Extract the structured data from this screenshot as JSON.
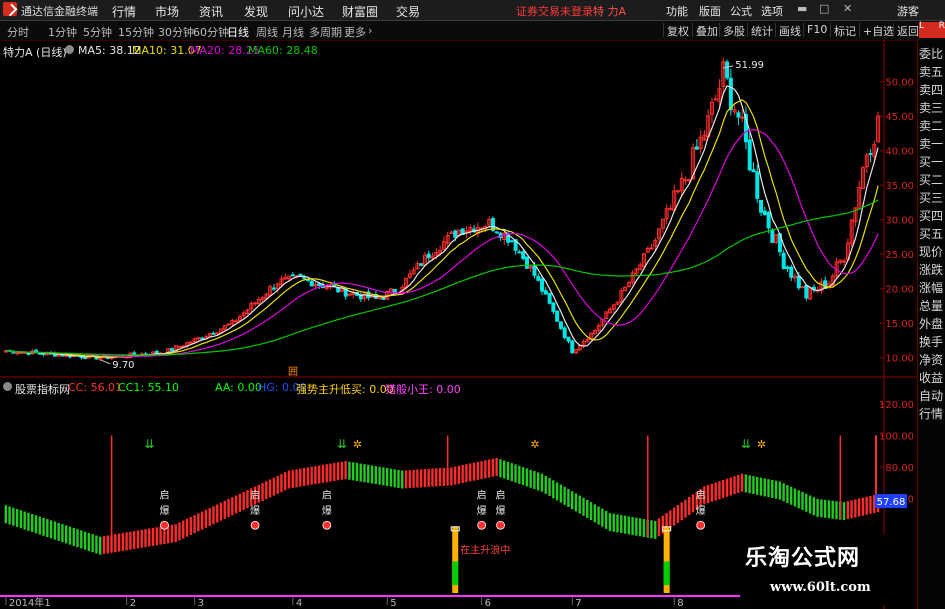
{
  "app": {
    "title": "通达信金融终端",
    "login_status": "证券交易未登录",
    "stock": "特 力A",
    "account": "游客"
  },
  "menu": [
    "行情",
    "市场",
    "资讯",
    "发现",
    "问小达",
    "财富圈",
    "交易"
  ],
  "right_menu": [
    "功能",
    "版面",
    "公式",
    "选项"
  ],
  "timeframes": [
    {
      "label": "分时",
      "active": false
    },
    {
      "label": "1分钟",
      "active": false
    },
    {
      "label": "5分钟",
      "active": false
    },
    {
      "label": "15分钟",
      "active": false
    },
    {
      "label": "30分钟",
      "active": false
    },
    {
      "label": "60分钟",
      "active": false
    },
    {
      "label": "日线",
      "active": true
    },
    {
      "label": "周线",
      "active": false
    },
    {
      "label": "月线",
      "active": false
    },
    {
      "label": "多周期",
      "active": false
    },
    {
      "label": "更多",
      "active": false
    }
  ],
  "tools": [
    "复权",
    "叠加",
    "多股",
    "统计",
    "画线",
    "F10",
    "标记",
    "+自选",
    "返回"
  ],
  "side_panel": {
    "badge_top": "L",
    "badge_sub": "R",
    "items": [
      "委比",
      "卖五",
      "卖四",
      "卖三",
      "卖二",
      "卖一",
      "买一",
      "买二",
      "买三",
      "买四",
      "买五",
      "现价",
      "涨跌",
      "涨幅",
      "总量",
      "外盘",
      "换手",
      "净资",
      "收益",
      "自动",
      "行情"
    ]
  },
  "colors": {
    "up": "#ff2d2d",
    "down": "#00e6e6",
    "ma5": "#e8e8e8",
    "ma10": "#e8e000",
    "ma20": "#e000e0",
    "ma60": "#00c800",
    "cc": "#ff3030",
    "cc1": "#00ff00",
    "aa": "#00ff00",
    "ribbon_up": "#ff2a2a",
    "ribbon_down": "#22cc22"
  },
  "chart_data": [
    {
      "type": "candlestick",
      "title": "特力A (日线)",
      "legend": [
        {
          "label": "MA5: 38.12",
          "color": "#e8e8e8"
        },
        {
          "label": "MA10: 31.07",
          "color": "#e8e000"
        },
        {
          "label": "MA20: 28.25",
          "color": "#e000e0"
        },
        {
          "label": "MA60: 28.48",
          "color": "#00c800"
        }
      ],
      "ylim": [
        7.5,
        54
      ],
      "yticks": [
        "50.00",
        "45.00",
        "40.00",
        "35.00",
        "30.00",
        "25.00",
        "20.00",
        "15.00",
        "10.00"
      ],
      "ytick_values": [
        50,
        45,
        40,
        35,
        30,
        25,
        20,
        15,
        10
      ],
      "anchors": [
        [
          0,
          11
        ],
        [
          18,
          10.3
        ],
        [
          25,
          10
        ],
        [
          42,
          10.8
        ],
        [
          52,
          13
        ],
        [
          60,
          15
        ],
        [
          66,
          18
        ],
        [
          72,
          21
        ],
        [
          78,
          21.5
        ],
        [
          84,
          20.5
        ],
        [
          90,
          19.5
        ],
        [
          98,
          18.5
        ],
        [
          104,
          20
        ],
        [
          112,
          25
        ],
        [
          120,
          28.5
        ],
        [
          128,
          29.5
        ],
        [
          134,
          27
        ],
        [
          140,
          22
        ],
        [
          146,
          15.5
        ],
        [
          150,
          11
        ],
        [
          156,
          14
        ],
        [
          164,
          20
        ],
        [
          172,
          27
        ],
        [
          180,
          36
        ],
        [
          186,
          44
        ],
        [
          190,
          51
        ],
        [
          194,
          45
        ],
        [
          200,
          32
        ],
        [
          206,
          24
        ],
        [
          212,
          19
        ],
        [
          218,
          21
        ],
        [
          222,
          25
        ],
        [
          228,
          40
        ],
        [
          231,
          44
        ]
      ],
      "series": [
        {
          "name": "MA5",
          "values": [
            38.12
          ]
        },
        {
          "name": "MA10",
          "values": [
            31.07
          ]
        },
        {
          "name": "MA20",
          "values": [
            28.25
          ]
        },
        {
          "name": "MA60",
          "values": [
            28.48
          ]
        }
      ],
      "annotations": [
        {
          "label": "51.99",
          "x": 190,
          "y": 51.99
        },
        {
          "label": "9.70",
          "x": 25,
          "y": 9.7
        }
      ],
      "event_marker": "囲"
    },
    {
      "type": "ribbon",
      "title": "股票指标网",
      "legend": [
        {
          "label": "CC: 56.01",
          "color": "#ff3030"
        },
        {
          "label": "CC1: 55.10",
          "color": "#00ff00"
        },
        {
          "label": "AA: 0.00",
          "color": "#00ff00"
        },
        {
          "label": "HG: 0.00",
          "color": "#2050ff"
        },
        {
          "label": "强势主升低买: 0.00",
          "color": "#ffd000"
        },
        {
          "label": "猎般小王: 0.00",
          "color": "#ff40ff"
        }
      ],
      "ylim": [
        0,
        125
      ],
      "yticks": [
        "120.00",
        "100.00",
        "80.00",
        "60.00"
      ],
      "ytick_values": [
        120,
        100,
        80,
        60
      ],
      "current_value": "57.68",
      "anchors": [
        [
          0,
          50
        ],
        [
          25,
          30
        ],
        [
          45,
          38
        ],
        [
          60,
          55
        ],
        [
          75,
          72
        ],
        [
          90,
          78
        ],
        [
          105,
          72
        ],
        [
          118,
          74
        ],
        [
          130,
          80
        ],
        [
          142,
          70
        ],
        [
          160,
          45
        ],
        [
          172,
          40
        ],
        [
          185,
          62
        ],
        [
          195,
          70
        ],
        [
          205,
          65
        ],
        [
          215,
          54
        ],
        [
          222,
          52
        ],
        [
          231,
          57
        ]
      ],
      "vertical_markers": [
        28,
        117,
        170,
        221
      ],
      "qi_bao": [
        {
          "x": 42,
          "top": "启",
          "bottom": "爆"
        },
        {
          "x": 66,
          "top": "启",
          "bottom": "爆"
        },
        {
          "x": 85,
          "top": "启",
          "bottom": "爆"
        },
        {
          "x": 126,
          "top": "启",
          "bottom": "爆"
        },
        {
          "x": 131,
          "top": "启",
          "bottom": "爆"
        },
        {
          "x": 184,
          "top": "启",
          "bottom": "爆"
        }
      ],
      "arrows": [
        {
          "x": 38
        },
        {
          "x": 89
        },
        {
          "x": 196
        }
      ],
      "figures": [
        {
          "x": 91
        },
        {
          "x": 138
        },
        {
          "x": 198
        }
      ],
      "rising_bars": [
        {
          "x": 119
        },
        {
          "x": 175
        }
      ],
      "rising_label": "在主升浪中",
      "x_ticks": [
        "2014年1",
        "2",
        "3",
        "4",
        "5",
        "6",
        "7",
        "8"
      ],
      "x_tick_pos": [
        0,
        32,
        50,
        76,
        101,
        126,
        150,
        177
      ]
    }
  ],
  "watermark": {
    "name": "乐淘公式网",
    "url": "www.60lt.com"
  }
}
